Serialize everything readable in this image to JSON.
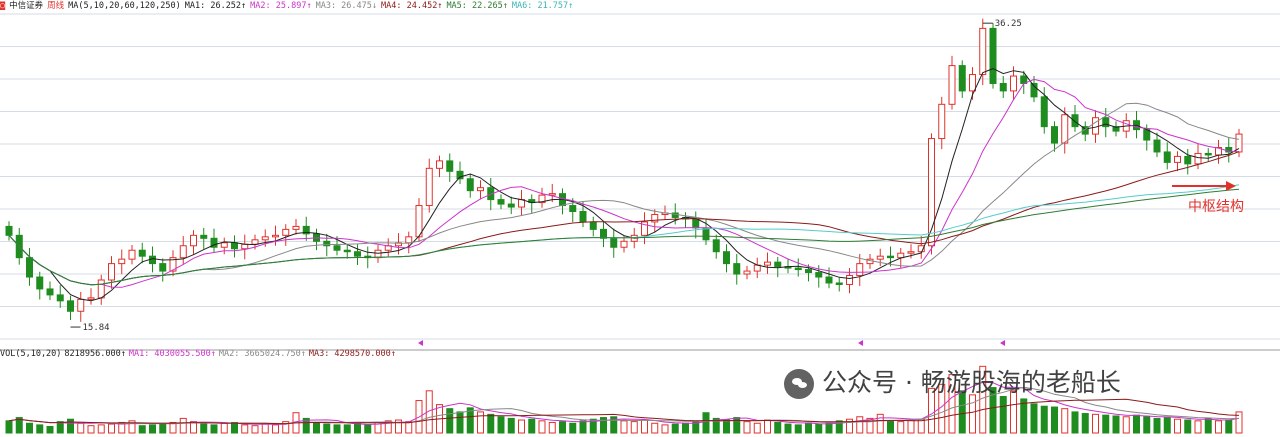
{
  "legend": {
    "name": "中信证券",
    "period": "周线",
    "ma_spec": "MA(5,10,20,60,120,250)",
    "ma1": "MA1: 26.252↑",
    "ma2": "MA2: 25.897↑",
    "ma3": "MA3: 26.475↓",
    "ma4": "MA4: 24.452↑",
    "ma5": "MA5: 22.265↑",
    "ma6": "MA6: 21.757↑"
  },
  "volume_legend": {
    "spec": "VOL(5,10,20)",
    "vol": "8218956.000↑",
    "ma1": "MA1: 4030055.500↑",
    "ma2": "MA2: 3665024.750↑",
    "ma3": "MA3: 4298570.000↑"
  },
  "annotations": {
    "high": "36.25",
    "low": "15.84",
    "box_label": "中枢结构"
  },
  "watermark": {
    "text": "公众号 · 畅游股海的老船长",
    "icon": "wechat-icon"
  },
  "colors": {
    "up": "#e0322b",
    "down": "#1e8c1e",
    "ma1": "#222222",
    "ma2": "#cc33cc",
    "ma3": "#888888",
    "ma4": "#8b1a1a",
    "ma5": "#55cccc",
    "ma6": "#2e7d32",
    "grid": "#d6dce5"
  },
  "chart_data": {
    "type": "candlestick",
    "ylim": [
      14.5,
      37
    ],
    "closes": [
      22.0,
      20.5,
      19.2,
      18.4,
      18.0,
      17.6,
      16.9,
      17.7,
      17.8,
      19.0,
      20.1,
      20.4,
      21.0,
      20.6,
      20.1,
      19.6,
      20.5,
      21.3,
      22.0,
      21.8,
      21.2,
      21.5,
      21.1,
      21.4,
      21.7,
      21.9,
      22.0,
      22.4,
      22.6,
      22.1,
      21.6,
      21.3,
      21.0,
      20.9,
      20.6,
      20.5,
      21.0,
      21.3,
      21.5,
      21.9,
      24.0,
      26.5,
      27.0,
      26.3,
      25.8,
      25.0,
      25.2,
      24.4,
      24.1,
      23.9,
      24.4,
      24.2,
      24.7,
      24.8,
      24.0,
      23.6,
      22.9,
      22.4,
      21.8,
      21.2,
      21.6,
      22.0,
      22.9,
      23.4,
      23.5,
      23.2,
      23.1,
      22.5,
      21.7,
      20.9,
      20.1,
      19.4,
      19.6,
      20.0,
      20.2,
      19.9,
      19.8,
      19.7,
      19.5,
      19.2,
      18.8,
      18.7,
      19.3,
      20.1,
      20.4,
      20.6,
      20.5,
      20.8,
      20.9,
      21.3,
      28.5,
      30.8,
      33.4,
      31.7,
      32.8,
      35.9,
      32.2,
      31.7,
      32.7,
      32.2,
      31.3,
      29.3,
      28.2,
      30.1,
      29.3,
      28.8,
      29.9,
      29.3,
      29.0,
      29.7,
      29.1,
      28.4,
      27.6,
      26.9,
      27.3,
      26.8,
      27.5,
      27.4,
      27.9,
      27.6,
      28.8
    ],
    "extremes": {
      "high": 36.25,
      "low": 15.84
    },
    "volume_ylim": [
      0,
      9000000
    ],
    "volumes": [
      1500000,
      1900000,
      1200000,
      1000000,
      800000,
      1400000,
      1700000,
      1200000,
      900000,
      1000000,
      1100000,
      1300000,
      1500000,
      900000,
      1000000,
      1100000,
      1300000,
      1800000,
      1400000,
      1100000,
      1000000,
      1200000,
      1300000,
      1000000,
      900000,
      1100000,
      1000000,
      1400000,
      2500000,
      1800000,
      1300000,
      1100000,
      1000000,
      1000000,
      1200000,
      1000000,
      1300000,
      1500000,
      1600000,
      1400000,
      4000000,
      5200000,
      3500000,
      3000000,
      2600000,
      3100000,
      2600000,
      2300000,
      2000000,
      1800000,
      1600000,
      1700000,
      1500000,
      1300000,
      1400000,
      1200000,
      1500000,
      1700000,
      1900000,
      2000000,
      1500000,
      1400000,
      1600000,
      1200000,
      1000000,
      1100000,
      1200000,
      1400000,
      2500000,
      1800000,
      1600000,
      1900000,
      1400000,
      1200000,
      1600000,
      1300000,
      1100000,
      1000000,
      1200000,
      1100000,
      1200000,
      1500000,
      1700000,
      2000000,
      1800000,
      2300000,
      1500000,
      1400000,
      1600000,
      1700000,
      5500000,
      6000000,
      7200000,
      5200000,
      4700000,
      8218956,
      5600000,
      4500000,
      5200000,
      4200000,
      3600000,
      3300000,
      3200000,
      3000000,
      2600000,
      2400000,
      2300000,
      2200000,
      2100000,
      2000000,
      2200000,
      2000000,
      1800000,
      1900000,
      1700000,
      1600000,
      1500000,
      1800000,
      1500000,
      1600000,
      2600000
    ],
    "ma_lines": [
      "ma1",
      "ma2",
      "ma3",
      "ma4",
      "ma5",
      "ma6"
    ]
  }
}
